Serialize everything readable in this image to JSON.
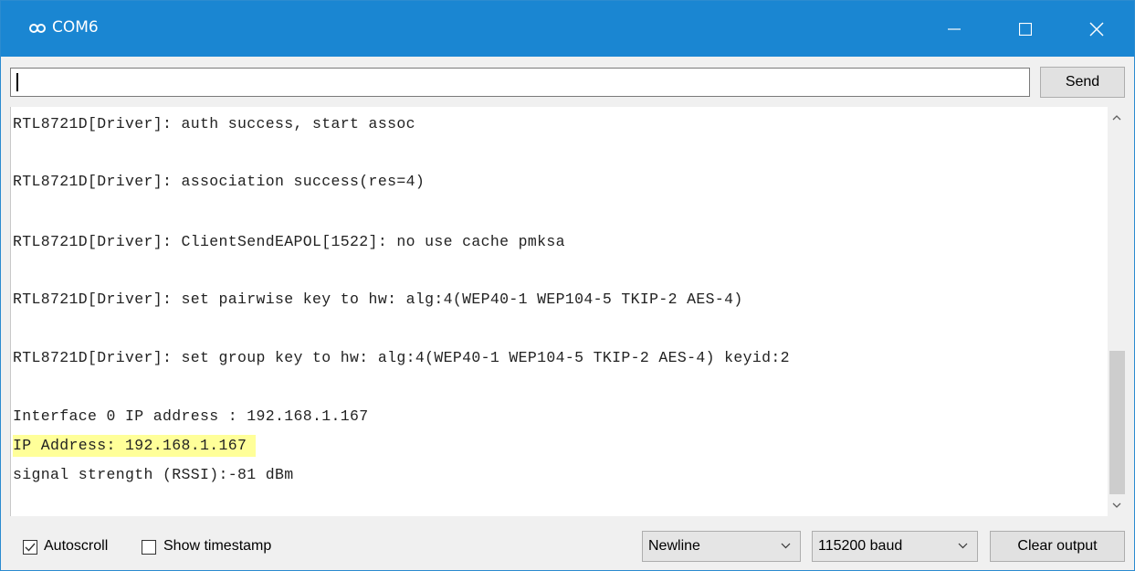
{
  "window": {
    "title": "COM6",
    "accent_color": "#1a86d2",
    "icons": [
      "arduino-icon",
      "minimize-icon",
      "maximize-icon",
      "close-icon"
    ]
  },
  "input": {
    "value": "",
    "send_label": "Send"
  },
  "output": {
    "lines": [
      "RTL8721D[Driver]: auth success, start assoc",
      "RTL8721D[Driver]: association success(res=4)",
      "RTL8721D[Driver]: ClientSendEAPOL[1522]: no use cache pmksa",
      "RTL8721D[Driver]: set pairwise key to hw: alg:4(WEP40-1 WEP104-5 TKIP-2 AES-4)",
      "RTL8721D[Driver]: set group key to hw: alg:4(WEP40-1 WEP104-5 TKIP-2 AES-4) keyid:2",
      "Interface 0 IP address : 192.168.1.167",
      "IP Address: 192.168.1.167",
      "signal strength (RSSI):-81 dBm"
    ],
    "highlight_color": "#ffff99"
  },
  "footer": {
    "autoscroll_label": "Autoscroll",
    "autoscroll_checked": true,
    "timestamp_label": "Show timestamp",
    "timestamp_checked": false,
    "line_ending": "Newline",
    "baud_rate": "115200 baud",
    "clear_label": "Clear output"
  }
}
